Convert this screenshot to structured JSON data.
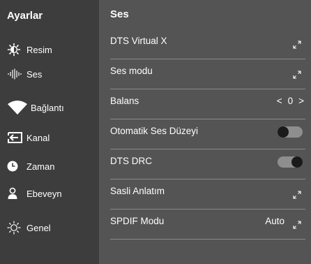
{
  "sidebar": {
    "title": "Ayarlar",
    "items": [
      {
        "label": "Resim",
        "icon": "brightness-icon"
      },
      {
        "label": "Ses",
        "icon": "sound-wave-icon"
      },
      {
        "label": "Bağlantı",
        "icon": "wifi-icon"
      },
      {
        "label": "Kanal",
        "icon": "input-icon"
      },
      {
        "label": "Zaman",
        "icon": "clock-icon"
      },
      {
        "label": "Ebeveyn",
        "icon": "user-icon"
      },
      {
        "label": "Genel",
        "icon": "sun-icon"
      }
    ]
  },
  "main": {
    "title": "Ses",
    "rows": [
      {
        "label": "DTS Virtual X",
        "control": "expand"
      },
      {
        "label": "Ses modu",
        "control": "expand"
      },
      {
        "label": "Balans",
        "control": "balance",
        "left": "<",
        "value": "0",
        "right": ">"
      },
      {
        "label": "Otomatik Ses Düzeyi",
        "control": "toggle",
        "state": "off"
      },
      {
        "label": "DTS DRC",
        "control": "toggle",
        "state": "on"
      },
      {
        "label": "Sasli Anlatım",
        "control": "expand"
      },
      {
        "label": "SPDIF Modu",
        "control": "value-expand",
        "value": "Auto"
      }
    ]
  },
  "colors": {
    "sidebar_bg": "#3d3d3d",
    "panel_bg": "#545454",
    "divider": "#8a8a8a",
    "toggle_track": "#8e8e8e",
    "toggle_knob": "#1a1a1a",
    "text": "#ffffff"
  }
}
